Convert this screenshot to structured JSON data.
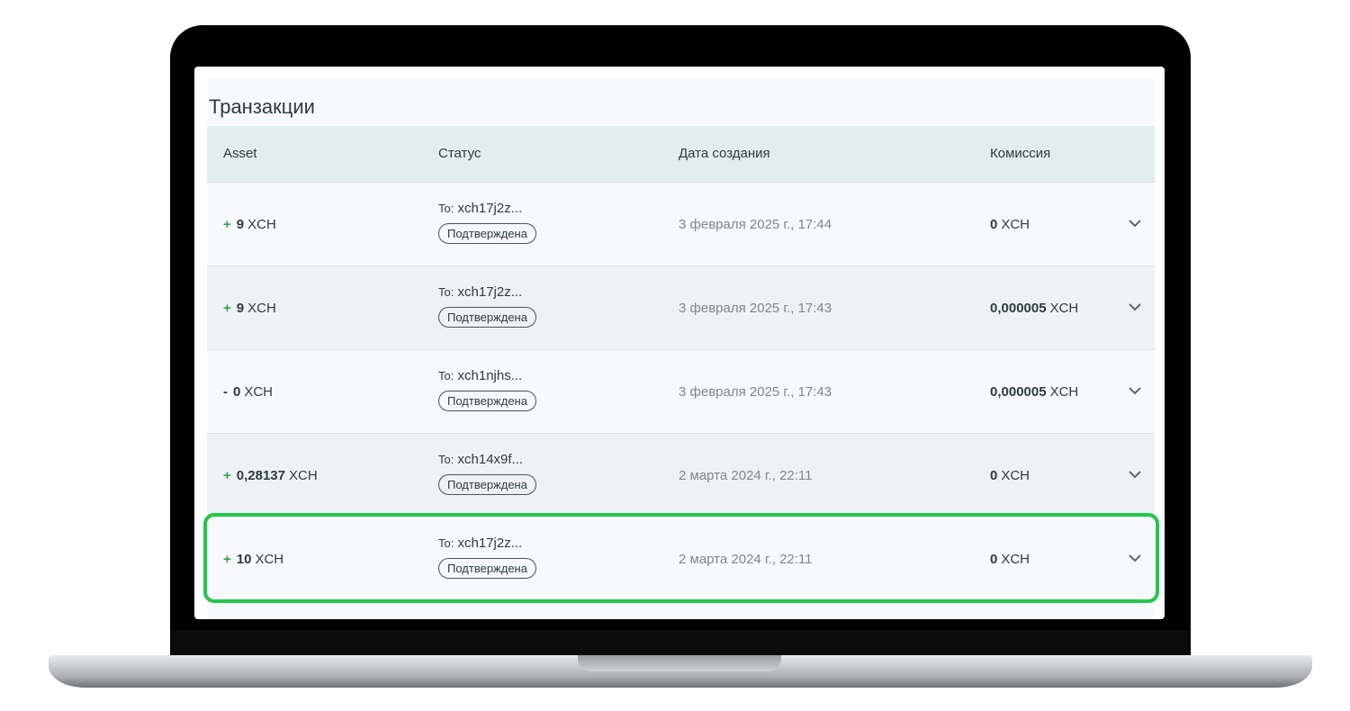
{
  "page": {
    "title": "Транзакции"
  },
  "table": {
    "columns": [
      "Asset",
      "Статус",
      "Дата создания",
      "Комиссия"
    ],
    "rows": [
      {
        "sign": "+",
        "amount": "9",
        "unit": "XCH",
        "to_label": "To:",
        "to_address": "xch17j2z...",
        "status": "Подтверждена",
        "date": "3 февраля 2025 г., 17:44",
        "fee_amount": "0",
        "fee_unit": "XCH"
      },
      {
        "sign": "+",
        "amount": "9",
        "unit": "XCH",
        "to_label": "To:",
        "to_address": "xch17j2z...",
        "status": "Подтверждена",
        "date": "3 февраля 2025 г., 17:43",
        "fee_amount": "0,000005",
        "fee_unit": "XCH"
      },
      {
        "sign": "-",
        "amount": "0",
        "unit": "XCH",
        "to_label": "To:",
        "to_address": "xch1njhs...",
        "status": "Подтверждена",
        "date": "3 февраля 2025 г., 17:43",
        "fee_amount": "0,000005",
        "fee_unit": "XCH"
      },
      {
        "sign": "+",
        "amount": "0,28137",
        "unit": "XCH",
        "to_label": "To:",
        "to_address": "xch14x9f...",
        "status": "Подтверждена",
        "date": "2 марта 2024 г., 22:11",
        "fee_amount": "0",
        "fee_unit": "XCH"
      },
      {
        "sign": "+",
        "amount": "10",
        "unit": "XCH",
        "to_label": "To:",
        "to_address": "xch17j2z...",
        "status": "Подтверждена",
        "date": "2 марта 2024 г., 22:11",
        "fee_amount": "0",
        "fee_unit": "XCH"
      }
    ]
  },
  "colors": {
    "positive": "#3aa047",
    "highlight": "#22c84a",
    "header_bg": "#e3eded"
  },
  "icons": {
    "expand": "chevron-down-icon"
  }
}
